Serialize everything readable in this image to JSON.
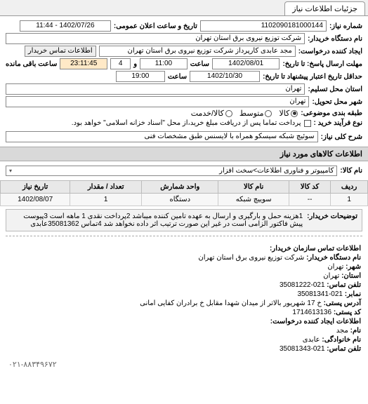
{
  "tab": {
    "title": "جزئیات اطلاعات نیاز"
  },
  "fields": {
    "number_label": "شماره نیاز:",
    "number_value": "1102090181000144",
    "announce_label": "تاریخ و ساعت اعلان عمومی:",
    "announce_value": "1402/07/26 - 11:44",
    "buyer_org_label": "نام دستگاه خریدار:",
    "buyer_org_value": "شرکت توزیع نیروی برق استان تهران",
    "creator_label": "ایجاد کننده درخواست:",
    "creator_value": "مجد عابدی کارپرداز شرکت توزیع نیروی برق استان تهران",
    "contact_btn": "اطلاعات تماس خریدار",
    "deadline_label": "مهلت ارسال پاسخ: تا تاریخ:",
    "deadline_date": "1402/08/01",
    "time_label": "ساعت",
    "deadline_time": "11:00",
    "remaining_label": "و",
    "remaining_days": "4",
    "remaining_time": "23:11:45",
    "remaining_suffix": "ساعت باقی مانده",
    "validity_label": "حداقل تاریخ اعتبار پیشنهاد تا تاریخ:",
    "validity_date": "1402/10/30",
    "validity_time": "19:00",
    "muni_label": "استان محل تسلیم:",
    "muni_value": "تهران",
    "city_label": "شهر محل تحویل:",
    "city_value": "تهران",
    "budget_label": "طبقه بندی موضوعی:",
    "radio_goods": "کالا",
    "radio_medium": "متوسط",
    "radio_service": "کالا/خدمت",
    "process_label": "نوع فرآیند خرید :",
    "process_note": "پرداخت تماما پس از دریافت مبلغ خرید،از محل \"اسناد خزانه اسلامی\" خواهد بود.",
    "desc_label": "شرح کلی نیاز:",
    "desc_value": "سوئیچ شبکه سیسکو همراه با لایسنس طبق مشخصات فنی"
  },
  "goods_header": "اطلاعات کالاهای مورد نیاز",
  "category_label": "نام کالا:",
  "category_value": "کامپیوتر و فناوری اطلاعات>سخت افزار",
  "table": {
    "headers": [
      "ردیف",
      "کد کالا",
      "نام کالا",
      "واحد شمارش",
      "تعداد / مقدار",
      "تاریخ نیاز"
    ],
    "row": [
      "1",
      "--",
      "سوییچ شبکه",
      "دستگاه",
      "1",
      "1402/08/07"
    ]
  },
  "buyer_note_label": "توضیحات خریدار:",
  "buyer_note": "1هزینه حمل و بارگیری و ارسال به عهده تامین کننده میباشد 2پرداخت نقدی 1 ماهه است 3پیوست پیش فاکتور الزامی است در غیر این صورت ترتیب اثر داده نخواهد شد 4تماس 35081362عابدی",
  "contact_header": "اطلاعات تماس سازمان خریدار:",
  "contact": {
    "org_label": "نام دستگاه خریدار:",
    "org": "شرکت توزیع نیروی برق استان تهران",
    "city_label": "شهر:",
    "city": "تهران",
    "province_label": "استان:",
    "province": "تهران",
    "phone_label": "تلفن تماس:",
    "phone": "021-35081222",
    "fax_label": "نمابر:",
    "fax": "021-35081341",
    "address_label": "آدرس پستی:",
    "address": "خ 17 شهریور بالاتر از میدان شهدا مقابل خ برادران کفایی امانی",
    "postal_label": "کد پستی:",
    "postal": "1714613136",
    "creator_header": "اطلاعات ایجاد کننده درخواست:",
    "name_label": "نام:",
    "name": "مجد",
    "family_label": "نام خانوادگی:",
    "family": "عابدی",
    "cphone_label": "تلفن تماس:",
    "cphone": "021-35081343"
  },
  "footer_phone": "۰۲۱-۸۸۳۴۹۶۷۲"
}
